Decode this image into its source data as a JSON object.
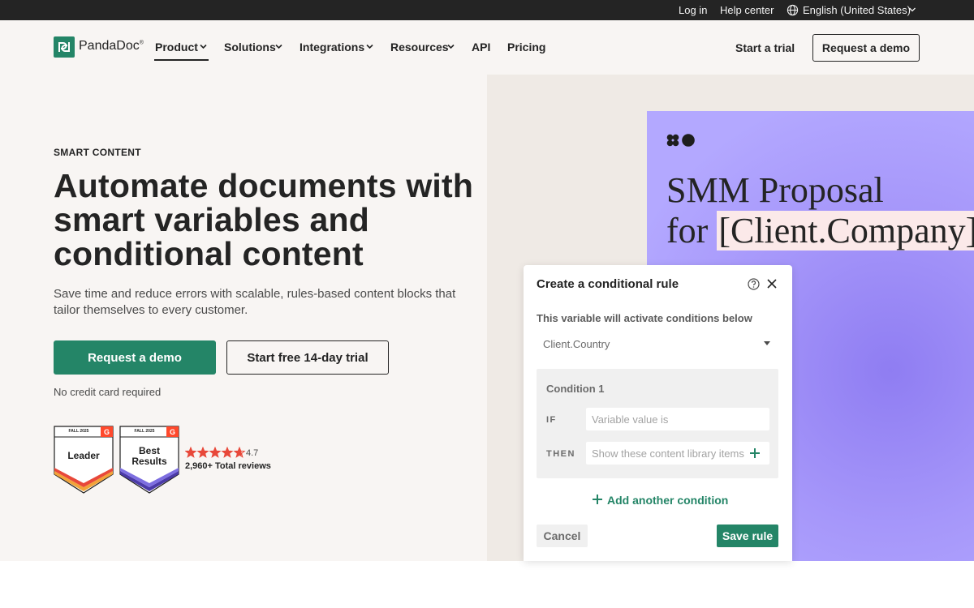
{
  "utility_bar": {
    "login": "Log in",
    "help": "Help center",
    "language": "English (United States)"
  },
  "header": {
    "logo_text": "PandaDoc",
    "logo_mark": "®",
    "nav": [
      {
        "label": "Product",
        "dropdown": true,
        "active": true
      },
      {
        "label": "Solutions",
        "dropdown": true
      },
      {
        "label": "Integrations",
        "dropdown": true
      },
      {
        "label": "Resources",
        "dropdown": true
      },
      {
        "label": "API",
        "dropdown": false
      },
      {
        "label": "Pricing",
        "dropdown": false
      }
    ],
    "start_trial": "Start a trial",
    "request_demo": "Request a demo"
  },
  "hero": {
    "eyebrow": "SMART CONTENT",
    "headline": "Automate documents with smart variables and conditional content",
    "subtext": "Save time and reduce errors with scalable, rules-based content blocks that tailor themselves to every customer.",
    "cta_primary": "Request a demo",
    "cta_secondary": "Start free 14-day trial",
    "note": "No credit card required",
    "badges": [
      {
        "season": "FALL 2025",
        "title": "Leader"
      },
      {
        "season": "FALL 2025",
        "title": "Best Results"
      }
    ],
    "rating": "4.7",
    "rating_value": 4.7,
    "reviews": "2,960+ Total reviews"
  },
  "proposal": {
    "line1": "SMM Proposal",
    "line2_prefix": "for ",
    "variable": "[Client.Company]"
  },
  "dialog": {
    "title": "Create a conditional rule",
    "subtitle": "This variable will activate conditions below",
    "selected_variable": "Client.Country",
    "condition_title": "Condition 1",
    "if_label": "IF",
    "if_placeholder": "Variable value is",
    "then_label": "THEN",
    "then_placeholder": "Show these content library items",
    "add_condition": "Add another condition",
    "cancel": "Cancel",
    "save": "Save rule"
  },
  "colors": {
    "brand_green": "#248567",
    "page_bg": "#f8f5f3",
    "proposal_purple": "#a697fa",
    "top_bar": "#242424"
  },
  "icons": [
    "globe-icon",
    "chevron-down-icon",
    "pandadoc-logo-icon",
    "help-icon",
    "close-icon",
    "plus-icon",
    "g2-icon",
    "star-icon"
  ]
}
